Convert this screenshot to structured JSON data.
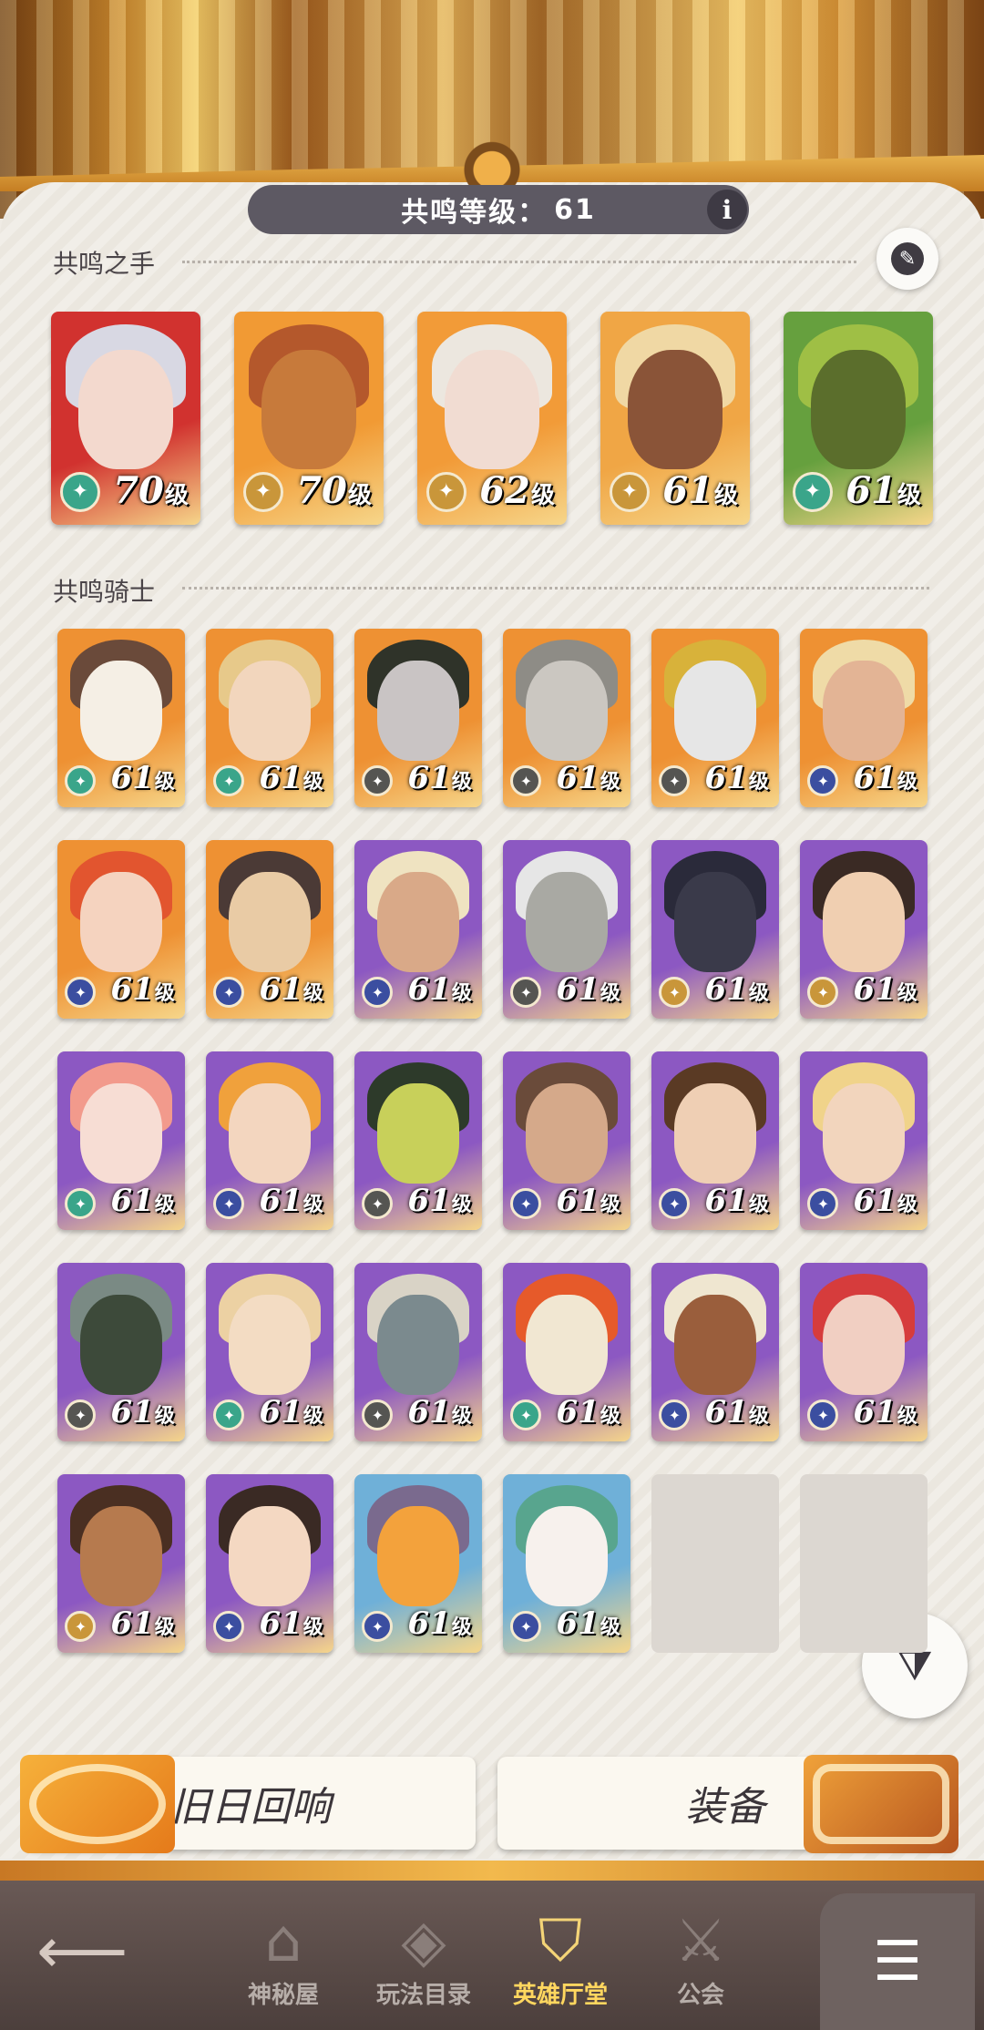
{
  "header": {
    "resonance_label": "共鸣等级：",
    "resonance_value": "61",
    "info_glyph": "i"
  },
  "hands": {
    "title": "共鸣之手",
    "heroes": [
      {
        "level": "70",
        "unit": "级",
        "bg": "#d1322f",
        "hair": "#d8d8e3",
        "face": "#f3d9ce",
        "badge": "#3aa58a",
        "badge_icon": "leaf"
      },
      {
        "level": "70",
        "unit": "级",
        "bg": "#f19a34",
        "hair": "#b4582c",
        "face": "#c77a3b",
        "badge": "#c9963a",
        "badge_icon": "emblem"
      },
      {
        "level": "62",
        "unit": "级",
        "bg": "#f29b38",
        "hair": "#ece7df",
        "face": "#f1dcd2",
        "badge": "#c9963a",
        "badge_icon": "emblem"
      },
      {
        "level": "61",
        "unit": "级",
        "bg": "#f0a645",
        "hair": "#f0d8a4",
        "face": "#8a5438",
        "badge": "#c9963a",
        "badge_icon": "emblem"
      },
      {
        "level": "61",
        "unit": "级",
        "bg": "#66a03e",
        "hair": "#9fbf45",
        "face": "#5b6e2c",
        "badge": "#3aa58a",
        "badge_icon": "leaf"
      }
    ]
  },
  "knights": {
    "title": "共鸣骑士",
    "heroes": [
      {
        "level": "61",
        "unit": "级",
        "bg": "#ee9133",
        "hair": "#6a4a3a",
        "face": "#f5efe5",
        "badge": "#3aa58a"
      },
      {
        "level": "61",
        "unit": "级",
        "bg": "#ee9133",
        "hair": "#e7c98a",
        "face": "#f2d6bd",
        "badge": "#3aa58a"
      },
      {
        "level": "61",
        "unit": "级",
        "bg": "#ee9133",
        "hair": "#2f3329",
        "face": "#c9c4c4",
        "badge": "#555552"
      },
      {
        "level": "61",
        "unit": "级",
        "bg": "#ee9133",
        "hair": "#8e8c86",
        "face": "#cbc7c1",
        "badge": "#555552"
      },
      {
        "level": "61",
        "unit": "级",
        "bg": "#ee9133",
        "hair": "#d8b23a",
        "face": "#e6e6e6",
        "badge": "#555552"
      },
      {
        "level": "61",
        "unit": "级",
        "bg": "#ee9133",
        "hair": "#efdba7",
        "face": "#e3b495",
        "badge": "#3b4ea0"
      },
      {
        "level": "61",
        "unit": "级",
        "bg": "#ee9133",
        "hair": "#e2552f",
        "face": "#f5d3bf",
        "badge": "#3b4ea0"
      },
      {
        "level": "61",
        "unit": "级",
        "bg": "#ee9133",
        "hair": "#4b3a36",
        "face": "#e9cba5",
        "badge": "#3b4ea0"
      },
      {
        "level": "61",
        "unit": "级",
        "bg": "#8c58c2",
        "hair": "#efe3c1",
        "face": "#d9a988",
        "badge": "#3b4ea0"
      },
      {
        "level": "61",
        "unit": "级",
        "bg": "#8c58c2",
        "hair": "#e6e6e6",
        "face": "#a9a9a3",
        "badge": "#555552"
      },
      {
        "level": "61",
        "unit": "级",
        "bg": "#8c58c2",
        "hair": "#2a2a3a",
        "face": "#3a3a4a",
        "badge": "#c9963a"
      },
      {
        "level": "61",
        "unit": "级",
        "bg": "#8c58c2",
        "hair": "#3a2a24",
        "face": "#f0cfb1",
        "badge": "#c9963a"
      },
      {
        "level": "61",
        "unit": "级",
        "bg": "#8c58c2",
        "hair": "#f29a8c",
        "face": "#f7ddd4",
        "badge": "#3aa58a"
      },
      {
        "level": "61",
        "unit": "级",
        "bg": "#8c58c2",
        "hair": "#f0a13c",
        "face": "#f3d6bf",
        "badge": "#3b4ea0"
      },
      {
        "level": "61",
        "unit": "级",
        "bg": "#8c58c2",
        "hair": "#2d3a2a",
        "face": "#c8d05a",
        "badge": "#555552"
      },
      {
        "level": "61",
        "unit": "级",
        "bg": "#8c58c2",
        "hair": "#6a4b3a",
        "face": "#d5a98a",
        "badge": "#3b4ea0"
      },
      {
        "level": "61",
        "unit": "级",
        "bg": "#8c58c2",
        "hair": "#5a3a24",
        "face": "#efcfb4",
        "badge": "#3b4ea0"
      },
      {
        "level": "61",
        "unit": "级",
        "bg": "#8c58c2",
        "hair": "#f0d38a",
        "face": "#f2d5bd",
        "badge": "#3b4ea0"
      },
      {
        "level": "61",
        "unit": "级",
        "bg": "#8c58c2",
        "hair": "#7a8a84",
        "face": "#3d4a3a",
        "badge": "#555552"
      },
      {
        "level": "61",
        "unit": "级",
        "bg": "#8c58c2",
        "hair": "#ecd1a3",
        "face": "#f3dcc3",
        "badge": "#3aa58a"
      },
      {
        "level": "61",
        "unit": "级",
        "bg": "#8c58c2",
        "hair": "#d9d3c6",
        "face": "#7b8a8e",
        "badge": "#555552"
      },
      {
        "level": "61",
        "unit": "级",
        "bg": "#8c58c2",
        "hair": "#e65a2a",
        "face": "#f1e7d2",
        "badge": "#3aa58a"
      },
      {
        "level": "61",
        "unit": "级",
        "bg": "#8c58c2",
        "hair": "#efe6d0",
        "face": "#9a5e3c",
        "badge": "#3b4ea0"
      },
      {
        "level": "61",
        "unit": "级",
        "bg": "#8c58c2",
        "hair": "#d63c3c",
        "face": "#f1cfc2",
        "badge": "#3b4ea0"
      },
      {
        "level": "61",
        "unit": "级",
        "bg": "#8c58c2",
        "hair": "#4a2f22",
        "face": "#b67a4e",
        "badge": "#c9963a"
      },
      {
        "level": "61",
        "unit": "级",
        "bg": "#8c58c2",
        "hair": "#3a2a24",
        "face": "#f4d8c2",
        "badge": "#3b4ea0"
      },
      {
        "level": "61",
        "unit": "级",
        "bg": "#6fb0d8",
        "hair": "#7a6a8e",
        "face": "#f3a23c",
        "badge": "#3b4ea0"
      },
      {
        "level": "61",
        "unit": "级",
        "bg": "#6fb0d8",
        "hair": "#58a58e",
        "face": "#f7f1ed",
        "badge": "#3b4ea0"
      }
    ],
    "empty_slots": 2
  },
  "actions": {
    "echo_label": "旧日回响",
    "equip_label": "装备"
  },
  "nav": {
    "back_icon": "back-arrow-icon",
    "items": [
      {
        "label": "神秘屋",
        "icon": "house-icon",
        "glyph": "⌂",
        "active": false
      },
      {
        "label": "玩法目录",
        "icon": "catalog-icon",
        "glyph": "◈",
        "active": false
      },
      {
        "label": "英雄厅堂",
        "icon": "helmet-icon",
        "glyph": "⛉",
        "active": true
      },
      {
        "label": "公会",
        "icon": "swords-icon",
        "glyph": "⚔",
        "active": false
      }
    ],
    "menu_icon": "menu-icon"
  },
  "colors": {
    "accent_gold": "#ffd75f",
    "panel": "#efebe4",
    "pill": "#5d5963"
  }
}
